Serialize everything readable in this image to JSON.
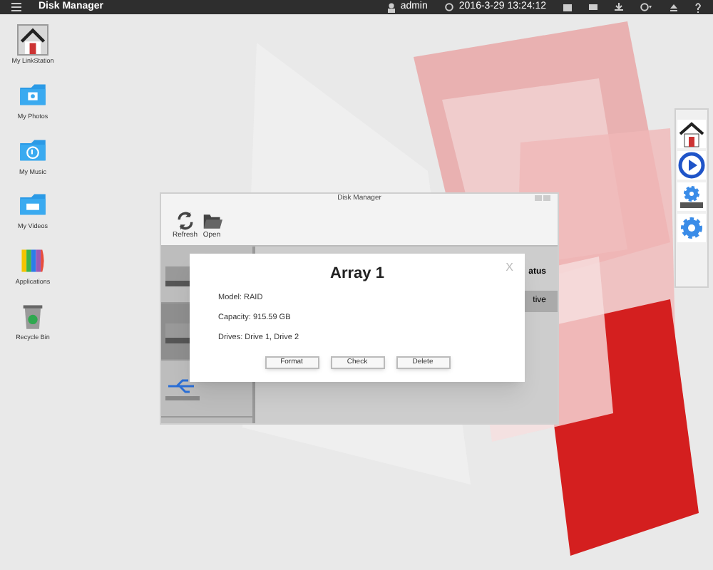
{
  "top_bar": {
    "title": "Disk Manager",
    "user": "admin",
    "datetime": "2016-3-29 13:24:12"
  },
  "desktop_icons": [
    {
      "kind": "home",
      "label": "My LinkStation",
      "selected": true
    },
    {
      "kind": "photos",
      "label": "My Photos",
      "selected": false
    },
    {
      "kind": "music",
      "label": "My Music",
      "selected": false
    },
    {
      "kind": "videos",
      "label": "My Videos",
      "selected": false
    },
    {
      "kind": "apps",
      "label": "Applications",
      "selected": false
    },
    {
      "kind": "trash",
      "label": "Recycle Bin",
      "selected": false
    }
  ],
  "window": {
    "title": "Disk Manager",
    "toolbar": [
      {
        "kind": "refresh",
        "label": "Refresh"
      },
      {
        "kind": "open",
        "label": "Open"
      }
    ],
    "right_fragments": [
      "atus",
      "tive"
    ],
    "disks": [
      {
        "kind": "hdd",
        "selected": false
      },
      {
        "kind": "hdd",
        "selected": true
      },
      {
        "kind": "usb",
        "selected": false
      }
    ]
  },
  "dialog": {
    "title": "Array 1",
    "close": "X",
    "lines": [
      "Model: RAID",
      "Capacity: 915.59 GB",
      "Drives: Drive 1, Drive 2"
    ],
    "buttons": [
      "Format",
      "Check",
      "Delete"
    ]
  },
  "dock": [
    {
      "kind": "home"
    },
    {
      "kind": "play"
    },
    {
      "kind": "drive-gear"
    },
    {
      "kind": "gear"
    }
  ]
}
